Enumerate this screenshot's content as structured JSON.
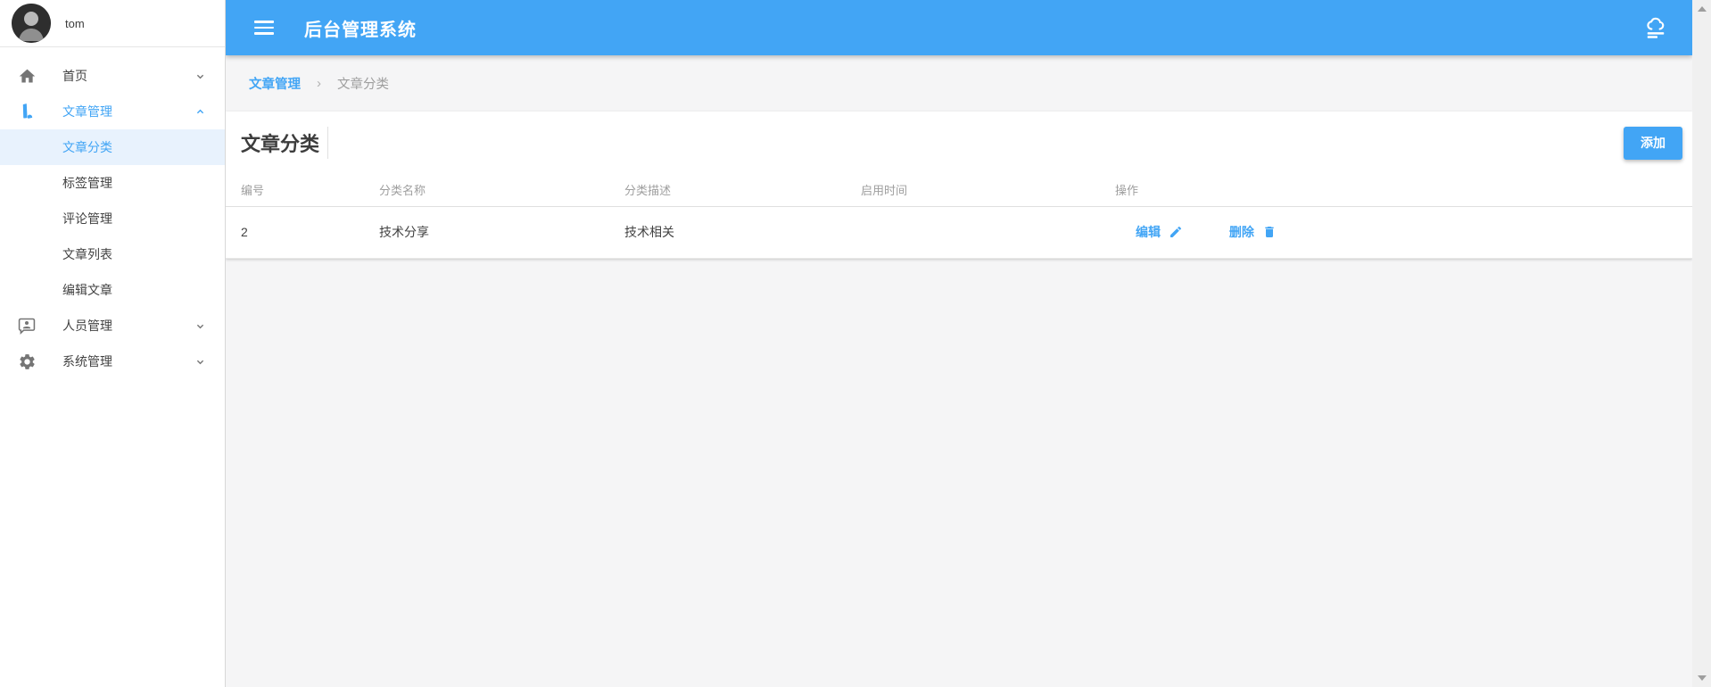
{
  "user": {
    "name": "tom"
  },
  "appbar": {
    "title": "后台管理系统"
  },
  "breadcrumb": {
    "separator": "›",
    "items": [
      {
        "label": "文章管理"
      },
      {
        "label": "文章分类"
      }
    ]
  },
  "sidebar": {
    "items": [
      {
        "label": "首页",
        "icon": "home-icon",
        "expanded": false
      },
      {
        "label": "文章管理",
        "icon": "article-pen-icon",
        "expanded": true,
        "children": [
          {
            "label": "文章分类",
            "selected": true
          },
          {
            "label": "标签管理",
            "selected": false
          },
          {
            "label": "评论管理",
            "selected": false
          },
          {
            "label": "文章列表",
            "selected": false
          },
          {
            "label": "编辑文章",
            "selected": false
          }
        ]
      },
      {
        "label": "人员管理",
        "icon": "people-chat-icon",
        "expanded": false
      },
      {
        "label": "系统管理",
        "icon": "settings-gear-icon",
        "expanded": false
      }
    ]
  },
  "page": {
    "title": "文章分类",
    "add_button_label": "添加"
  },
  "table": {
    "columns": [
      "编号",
      "分类名称",
      "分类描述",
      "启用时间",
      "操作"
    ],
    "rows": [
      {
        "id": "2",
        "name": "技术分享",
        "description": "技术相关",
        "enable_time": "",
        "edit_label": "编辑",
        "delete_label": "删除"
      }
    ]
  },
  "colors": {
    "primary": "#42a5f5",
    "selected_item_bg": "#e8f2fd",
    "page_bg": "#f5f5f6",
    "muted_text": "#9e9e9e"
  }
}
